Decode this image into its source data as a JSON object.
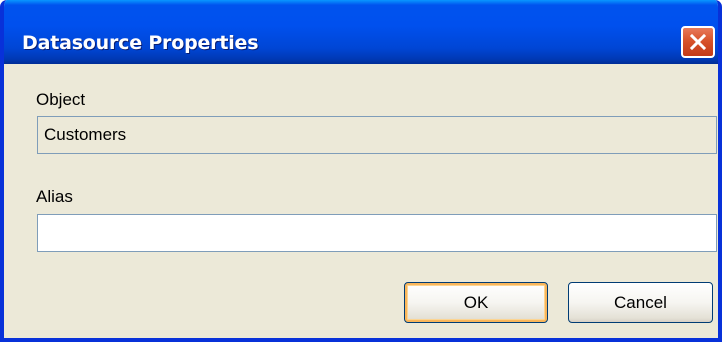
{
  "dialog": {
    "title": "Datasource Properties",
    "close_icon": "close-icon"
  },
  "object": {
    "label": "Object",
    "value": "Customers"
  },
  "alias": {
    "label": "Alias",
    "value": ""
  },
  "buttons": {
    "ok_label": "OK",
    "cancel_label": "Cancel"
  },
  "colors": {
    "titlebar": "#0053ee",
    "window_face": "#ece9d8",
    "close_button": "#d8532b",
    "field_border": "#7f9db9",
    "default_button_highlight": "#f9b65b"
  }
}
